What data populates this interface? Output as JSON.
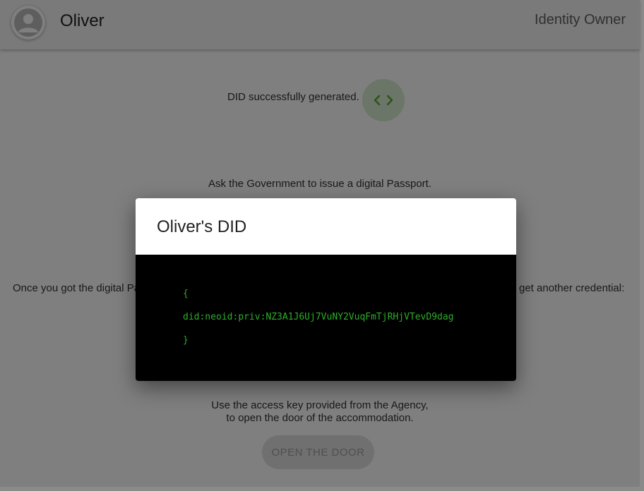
{
  "appbar": {
    "user_name": "Oliver",
    "role": "Identity Owner",
    "avatar_icon": "account-circle-icon"
  },
  "steps": {
    "did_status": "DID successfully generated.",
    "code_icon": "code-brackets-icon",
    "ask_government": "Ask the Government to issue a digital Passport.",
    "once_got": "Once you got the digital Pa",
    "once_got_tail": "get another credential:",
    "access_key_line1": "Use the access key provided from the Agency,",
    "access_key_line2": "to open the door of the accommodation.",
    "open_door_label": "OPEN THE DOOR"
  },
  "modal": {
    "title": "Oliver's DID",
    "code_open": "{",
    "did": "did:neoid:priv:NZ3A1J6Uj7VuNY2VuqFmTjRHjVTevD9dag",
    "code_close": "}"
  },
  "colors": {
    "code_text": "#2fae2b",
    "code_icon": "#5aa532",
    "overlay": "rgba(0,0,0,0.5)"
  }
}
